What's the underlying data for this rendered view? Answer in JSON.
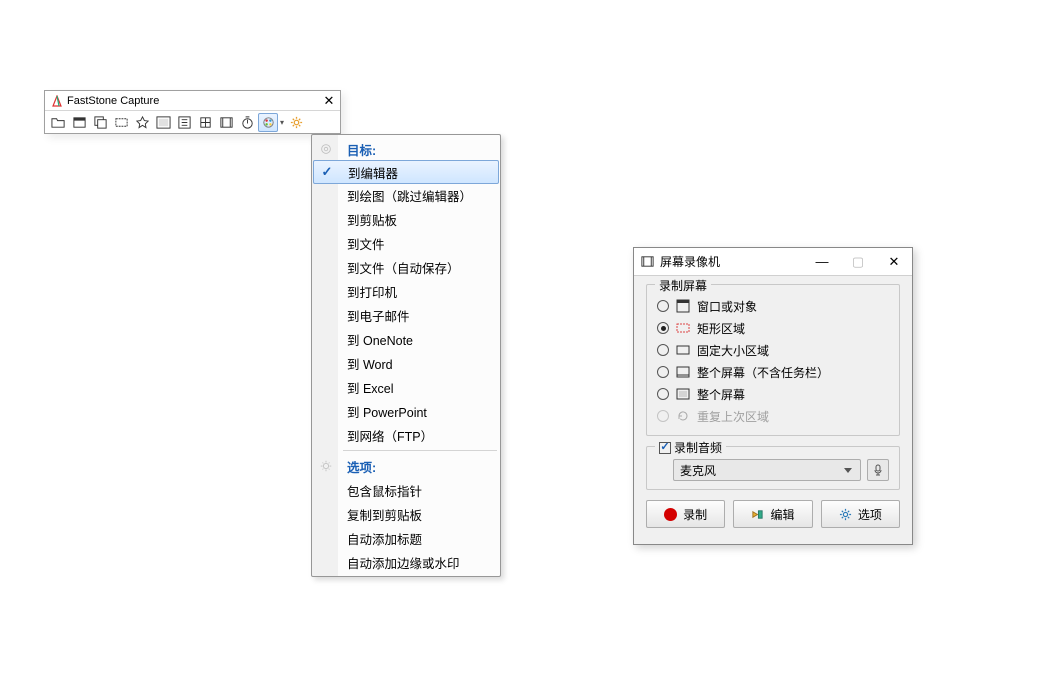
{
  "faststone": {
    "title": "FastStone Capture",
    "toolbar_buttons": [
      {
        "name": "open-icon"
      },
      {
        "name": "active-window-icon"
      },
      {
        "name": "window-object-icon"
      },
      {
        "name": "rect-region-icon"
      },
      {
        "name": "freehand-icon"
      },
      {
        "name": "fullscreen-icon"
      },
      {
        "name": "scrolling-icon"
      },
      {
        "name": "fixed-region-icon"
      },
      {
        "name": "video-icon"
      },
      {
        "name": "timer-icon"
      },
      {
        "name": "output-options-icon"
      },
      {
        "name": "settings-icon"
      }
    ]
  },
  "menu": {
    "target_header": "目标:",
    "target_items": [
      {
        "label": "到编辑器",
        "checked": true,
        "name": "editor"
      },
      {
        "label": "到绘图（跳过编辑器）",
        "name": "paint"
      },
      {
        "label": "到剪贴板",
        "name": "clipboard"
      },
      {
        "label": "到文件",
        "name": "file"
      },
      {
        "label": "到文件（自动保存）",
        "name": "file-autosave"
      },
      {
        "label": "到打印机",
        "name": "printer"
      },
      {
        "label": "到电子邮件",
        "name": "email"
      },
      {
        "label": "到 OneNote",
        "name": "onenote"
      },
      {
        "label": "到 Word",
        "name": "word"
      },
      {
        "label": "到 Excel",
        "name": "excel"
      },
      {
        "label": "到 PowerPoint",
        "name": "powerpoint"
      },
      {
        "label": "到网络（FTP）",
        "name": "ftp"
      }
    ],
    "options_header": "选项:",
    "options_items": [
      {
        "label": "包含鼠标指针",
        "name": "include-cursor"
      },
      {
        "label": "复制到剪贴板",
        "name": "copy-clipboard"
      },
      {
        "label": "自动添加标题",
        "name": "auto-caption"
      },
      {
        "label": "自动添加边缘或水印",
        "name": "auto-edge"
      }
    ]
  },
  "recorder": {
    "title": "屏幕录像机",
    "group_record": "录制屏幕",
    "modes": [
      {
        "label": "窗口或对象",
        "icon": "window",
        "checked": false,
        "name": "rec-window"
      },
      {
        "label": "矩形区域",
        "icon": "rect-dashed",
        "checked": true,
        "name": "rec-rect"
      },
      {
        "label": "固定大小区域",
        "icon": "rect-solid",
        "checked": false,
        "name": "rec-fixed"
      },
      {
        "label": "整个屏幕（不含任务栏）",
        "icon": "fullscreen-notb",
        "checked": false,
        "name": "rec-full-notb"
      },
      {
        "label": "整个屏幕",
        "icon": "fullscreen",
        "checked": false,
        "name": "rec-full"
      },
      {
        "label": "重复上次区域",
        "icon": "repeat",
        "checked": false,
        "disabled": true,
        "name": "rec-repeat"
      }
    ],
    "group_audio": "录制音频",
    "audio_checked": true,
    "audio_source": "麦克风",
    "buttons": {
      "record": "录制",
      "edit": "编辑",
      "options": "选项"
    }
  }
}
